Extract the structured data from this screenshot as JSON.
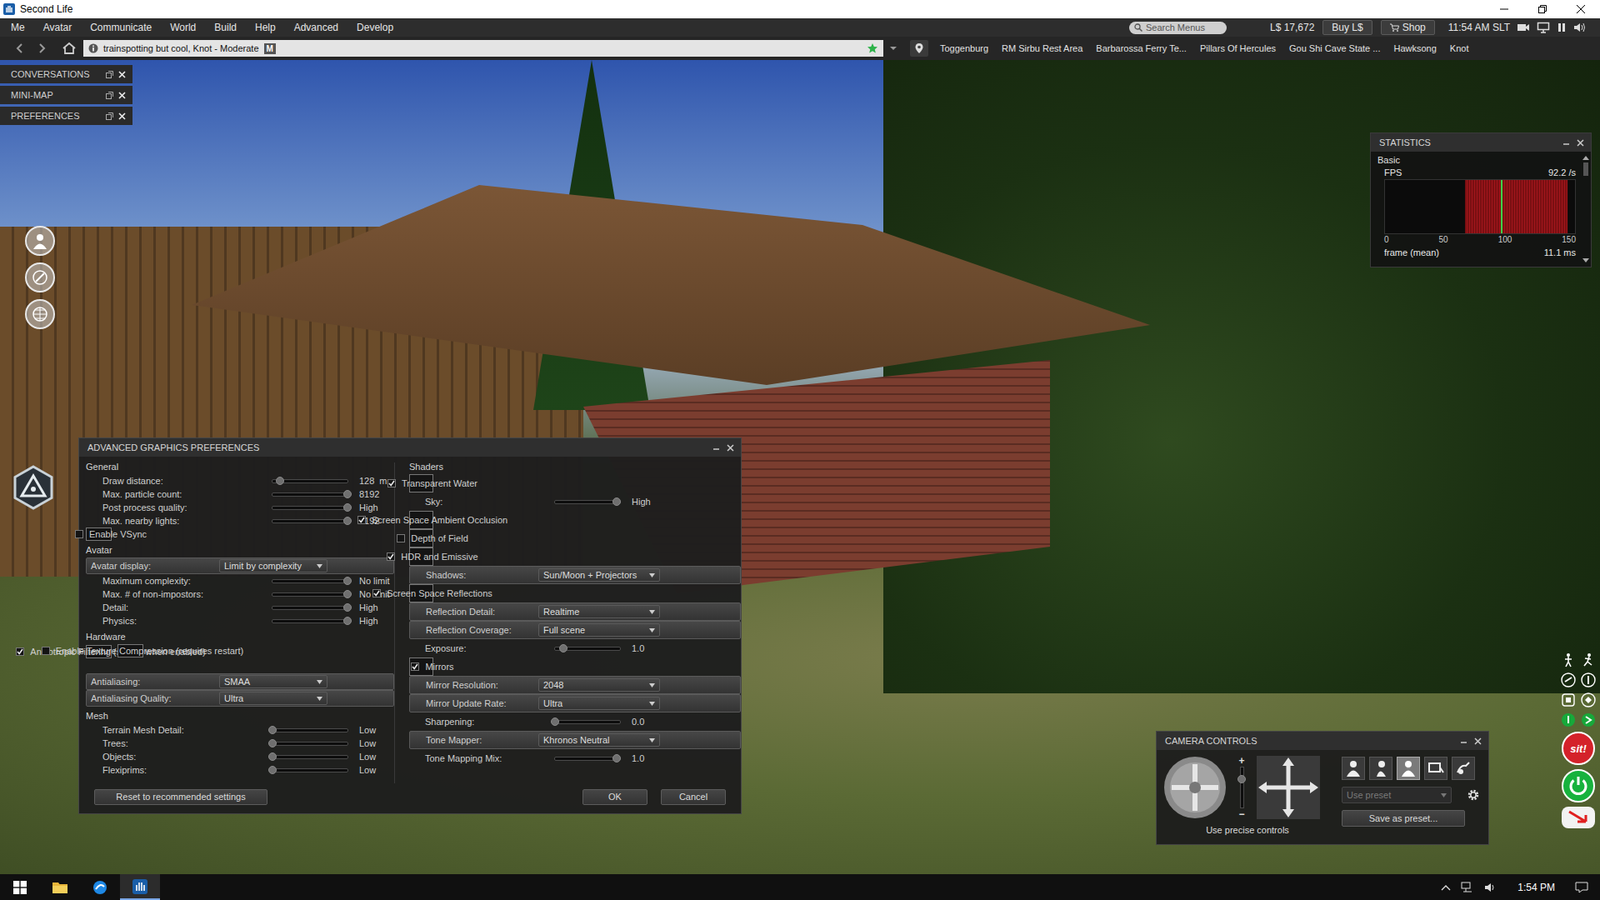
{
  "window": {
    "title": "Second Life"
  },
  "menu": [
    "Me",
    "Avatar",
    "Communicate",
    "World",
    "Build",
    "Help",
    "Advanced",
    "Develop"
  ],
  "status": {
    "search_placeholder": "Search Menus",
    "balance": "L$ 17,672",
    "buy": "Buy L$",
    "shop": "Shop",
    "time": "11:54 AM SLT"
  },
  "navbar": {
    "location": "trainspotting but cool, Knot - Moderate",
    "rating_badge": "M",
    "favorites": [
      "Toggenburg",
      "RM Sirbu Rest Area",
      "Barbarossa Ferry Te...",
      "Pillars Of Hercules",
      "Gou Shi Cave State ...",
      "Hawksong",
      "Knot"
    ]
  },
  "floaters": [
    "CONVERSATIONS",
    "MINI-MAP",
    "PREFERENCES"
  ],
  "statistics": {
    "title": "STATISTICS",
    "group": "Basic",
    "stat": "FPS",
    "reading": "92.2 /s",
    "level": 0.61,
    "band_start": 0.42,
    "band_end": 0.96,
    "ticks": [
      "0",
      "50",
      "100",
      "150"
    ],
    "next_stat": "frame (mean)",
    "next_reading": "11.1 ms"
  },
  "graphics": {
    "title": "ADVANCED GRAPHICS PREFERENCES",
    "left_sections": [
      {
        "heading": "General",
        "rows": [
          {
            "kind": "slider",
            "label": "Draw distance:",
            "level": 0.1,
            "value": "128",
            "unit": "m"
          },
          {
            "kind": "slider",
            "label": "Max. particle count:",
            "level": 1,
            "value": "8192"
          },
          {
            "kind": "slider",
            "label": "Post process quality:",
            "level": 1,
            "value": "High"
          },
          {
            "kind": "slider",
            "label": "Max. nearby lights:",
            "level": 1,
            "value": "8192"
          },
          {
            "kind": "checkbox",
            "label": "Enable VSync",
            "checked": false
          }
        ]
      },
      {
        "heading": "Avatar",
        "rows": [
          {
            "kind": "dropdown",
            "label": "Avatar display:",
            "value": "Limit by complexity"
          },
          {
            "kind": "slider",
            "label": "Maximum complexity:",
            "level": 1,
            "value": "No limit"
          },
          {
            "kind": "slider",
            "label": "Max. # of non-impostors:",
            "level": 1,
            "value": "No limit"
          },
          {
            "kind": "slider",
            "label": "Detail:",
            "level": 1,
            "value": "High"
          },
          {
            "kind": "slider",
            "label": "Physics:",
            "level": 1,
            "value": "High"
          }
        ]
      },
      {
        "heading": "Hardware",
        "rows": [
          {
            "kind": "checkbox",
            "label": "Anisotropic Filtering (slower when enabled)",
            "checked": true
          },
          {
            "kind": "checkbox",
            "label": "Enable Texture Compression (requires restart)",
            "checked": false
          },
          {
            "kind": "dropdown",
            "label": "Antialiasing:",
            "value": "SMAA"
          },
          {
            "kind": "dropdown",
            "label": "Antialiasing Quality:",
            "value": "Ultra"
          }
        ]
      },
      {
        "heading": "Mesh",
        "rows": [
          {
            "kind": "slider",
            "label": "Terrain Mesh Detail:",
            "level": 0,
            "value": "Low"
          },
          {
            "kind": "slider",
            "label": "Trees:",
            "level": 0,
            "value": "Low"
          },
          {
            "kind": "slider",
            "label": "Objects:",
            "level": 0,
            "value": "Low"
          },
          {
            "kind": "slider",
            "label": "Flexiprims:",
            "level": 0,
            "value": "Low"
          }
        ]
      }
    ],
    "shaders_heading": "Shaders",
    "shaders": [
      {
        "kind": "checkbox",
        "label": "Transparent Water",
        "checked": true
      },
      {
        "kind": "slider",
        "label": "Sky:",
        "level": 0.95,
        "value": "High"
      },
      {
        "kind": "checkbox",
        "label": "Screen Space Ambient Occlusion",
        "checked": true
      },
      {
        "kind": "checkbox",
        "label": "Depth of Field",
        "checked": false
      },
      {
        "kind": "checkbox",
        "label": "HDR and Emissive",
        "checked": true
      },
      {
        "kind": "dropdown",
        "label": "Shadows:",
        "value": "Sun/Moon + Projectors"
      },
      {
        "kind": "checkbox",
        "label": "Screen Space Reflections",
        "checked": true
      },
      {
        "kind": "dropdown",
        "label": "Reflection Detail:",
        "value": "Realtime"
      },
      {
        "kind": "dropdown",
        "label": "Reflection Coverage:",
        "value": "Full scene"
      },
      {
        "kind": "slider",
        "label": "Exposure:",
        "level": 0.13,
        "value": "1.0"
      },
      {
        "kind": "checkbox",
        "label": "Mirrors",
        "checked": true
      },
      {
        "kind": "dropdown",
        "label": "Mirror Resolution:",
        "value": "2048"
      },
      {
        "kind": "dropdown",
        "label": "Mirror Update Rate:",
        "value": "Ultra"
      },
      {
        "kind": "slider",
        "label": "Sharpening:",
        "level": 0,
        "value": "0.0"
      },
      {
        "kind": "dropdown",
        "label": "Tone Mapper:",
        "value": "Khronos Neutral"
      },
      {
        "kind": "slider",
        "label": "Tone Mapping Mix:",
        "level": 0.95,
        "value": "1.0"
      }
    ],
    "buttons": {
      "reset": "Reset to recommended settings",
      "ok": "OK",
      "cancel": "Cancel"
    }
  },
  "camera": {
    "title": "CAMERA CONTROLS",
    "modes": [
      {
        "kind": "front",
        "selected": false
      },
      {
        "kind": "side",
        "selected": false
      },
      {
        "kind": "rear",
        "selected": true
      },
      {
        "kind": "object",
        "selected": false
      },
      {
        "kind": "mouselook",
        "selected": false
      }
    ],
    "preset_placeholder": "Use preset",
    "save": "Save as preset...",
    "precise": "Use precise controls",
    "zoom_in": "+",
    "zoom_out": "−",
    "zoom_level": 0.7
  },
  "side_button": "sit!",
  "taskbar": {
    "time": "1:54 PM"
  }
}
